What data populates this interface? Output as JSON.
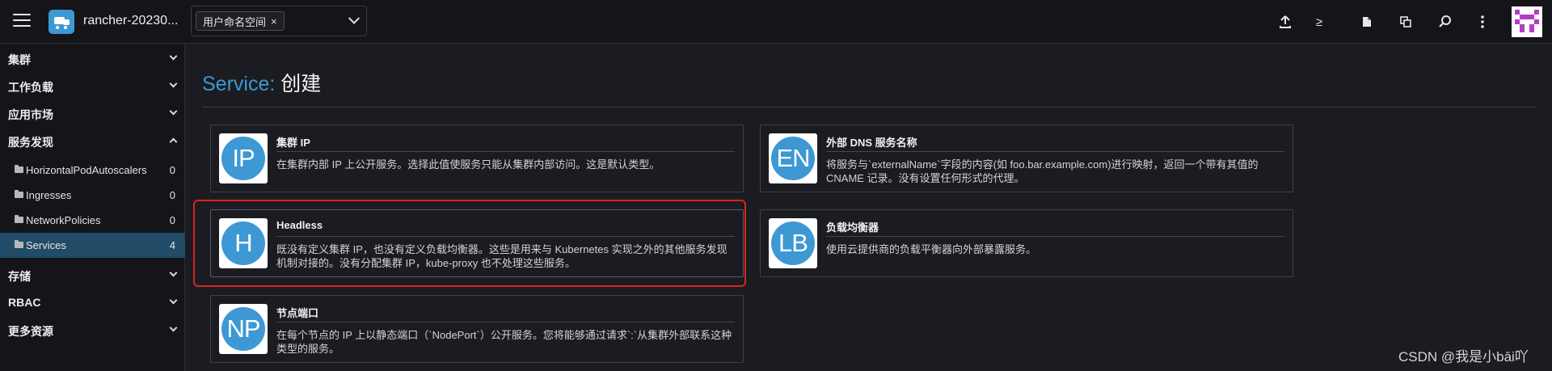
{
  "header": {
    "cluster_name": "rancher-20230...",
    "namespace_filter": {
      "chip_label": "用户命名空间",
      "chip_remove": "×"
    },
    "icons": [
      "upload-icon",
      "terminal-icon",
      "file-icon",
      "copy-icon",
      "search-icon",
      "more-vertical-icon"
    ],
    "prompt_glyph": "≥"
  },
  "sidebar": {
    "groups": [
      {
        "label": "集群",
        "expanded": false
      },
      {
        "label": "工作负载",
        "expanded": false
      },
      {
        "label": "应用市场",
        "expanded": false
      },
      {
        "label": "服务发现",
        "expanded": true
      },
      {
        "label": "存储",
        "expanded": false
      },
      {
        "label": "RBAC",
        "expanded": false
      },
      {
        "label": "更多资源",
        "expanded": false
      }
    ],
    "items": [
      {
        "label": "HorizontalPodAutoscalers",
        "count": "0"
      },
      {
        "label": "Ingresses",
        "count": "0"
      },
      {
        "label": "NetworkPolicies",
        "count": "0"
      },
      {
        "label": "Services",
        "count": "4",
        "active": true
      }
    ]
  },
  "page": {
    "title_prefix": "Service:",
    "title_action": "创建"
  },
  "cards": [
    {
      "abbr": "IP",
      "title": "集群 IP",
      "desc": "在集群内部 IP 上公开服务。选择此值使服务只能从集群内部访问。这是默认类型。"
    },
    {
      "abbr": "EN",
      "title": "外部 DNS 服务名称",
      "desc": "将服务与`externalName`字段的内容(如 foo.bar.example.com)进行映射，返回一个带有其值的 CNAME 记录。没有设置任何形式的代理。"
    },
    {
      "abbr": "H",
      "title": "Headless",
      "desc": "既没有定义集群 IP，也没有定义负载均衡器。这些是用来与 Kubernetes 实现之外的其他服务发现机制对接的。没有分配集群 IP，kube-proxy 也不处理这些服务。"
    },
    {
      "abbr": "LB",
      "title": "负载均衡器",
      "desc": "使用云提供商的负载平衡器向外部暴露服务。"
    },
    {
      "abbr": "NP",
      "title": "节点端口",
      "desc": "在每个节点的 IP 上以静态端口（`NodePort`）公开服务。您将能够通过请求`:`从集群外部联系这种类型的服务。"
    }
  ],
  "watermark": "CSDN @我是小bāi吖",
  "colors": {
    "accent": "#3d98d3",
    "highlight": "#d7261e",
    "active_nav": "#214b66"
  }
}
